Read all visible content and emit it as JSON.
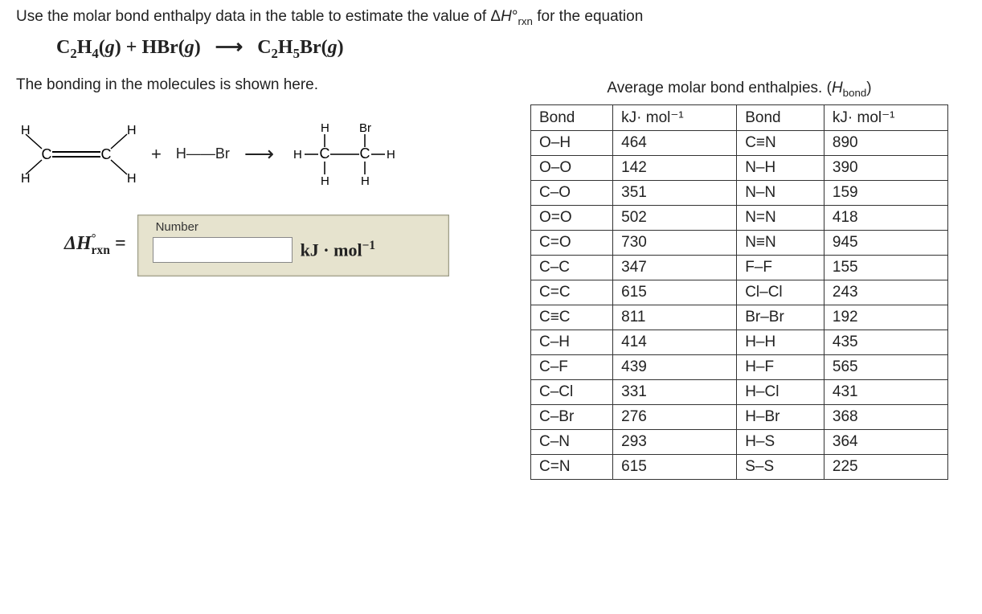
{
  "question": {
    "line1_a": "Use the molar bond enthalpy data in the table to estimate the value of Δ",
    "line1_b": "H",
    "line1_c": "°",
    "line1_d": "rxn",
    "line1_e": " for the equation",
    "equation_html": "C<span class='sub'>2</span>H<span class='sub'>4</span>(<span class='italic'>g</span>) + HBr(<span class='italic'>g</span>)&nbsp;&nbsp;&nbsp;⟶&nbsp;&nbsp;&nbsp;C<span class='sub'>2</span>H<span class='sub'>5</span>Br(<span class='italic'>g</span>)",
    "line2": "The bonding in the molecules is shown here."
  },
  "table": {
    "title_a": "Average molar bond enthalpies. (",
    "title_b": "H",
    "title_c": "bond",
    "title_d": ")",
    "headers": [
      "Bond",
      "kJ· mol⁻¹",
      "Bond",
      "kJ· mol⁻¹"
    ],
    "rows": [
      [
        "O–H",
        "464",
        "C≡N",
        "890"
      ],
      [
        "O–O",
        "142",
        "N–H",
        "390"
      ],
      [
        "C–O",
        "351",
        "N–N",
        "159"
      ],
      [
        "O=O",
        "502",
        "N=N",
        "418"
      ],
      [
        "C=O",
        "730",
        "N≡N",
        "945"
      ],
      [
        "C–C",
        "347",
        "F–F",
        "155"
      ],
      [
        "C=C",
        "615",
        "Cl–Cl",
        "243"
      ],
      [
        "C≡C",
        "811",
        "Br–Br",
        "192"
      ],
      [
        "C–H",
        "414",
        "H–H",
        "435"
      ],
      [
        "C–F",
        "439",
        "H–F",
        "565"
      ],
      [
        "C–Cl",
        "331",
        "H–Cl",
        "431"
      ],
      [
        "C–Br",
        "276",
        "H–Br",
        "368"
      ],
      [
        "C–N",
        "293",
        "H–S",
        "364"
      ],
      [
        "C=N",
        "615",
        "S–S",
        "225"
      ]
    ]
  },
  "diagram": {
    "plus": "+",
    "hbr": "H——Br",
    "arrow": "⟶"
  },
  "answer": {
    "dh_html": "Δ<span class='italic'>H</span><span style='font-style:normal;font-size:0.6em;vertical-align:super'>°</span><span style='font-style:normal;font-size:0.65em;vertical-align:sub;margin-left:-6px'>rxn</span> =",
    "input_label": "Number",
    "input_value": "",
    "unit_html": "kJ · mol<span style='font-size:0.7em;vertical-align:super'>−1</span>"
  }
}
